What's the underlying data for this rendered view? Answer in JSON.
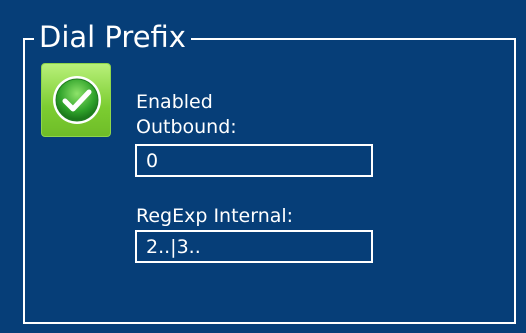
{
  "panel": {
    "title": "Dial Prefix",
    "colors": {
      "background": "#063e78",
      "text": "#ffffff",
      "toggle_green": "#7ccd31"
    }
  },
  "enabled_toggle": {
    "icon": "check-circle-icon",
    "checked": true
  },
  "fields": {
    "enabled_label": "Enabled",
    "outbound": {
      "label": "Outbound:",
      "value": "0"
    },
    "regexp_internal": {
      "label": "RegExp Internal:",
      "value": "2..|3.."
    }
  }
}
